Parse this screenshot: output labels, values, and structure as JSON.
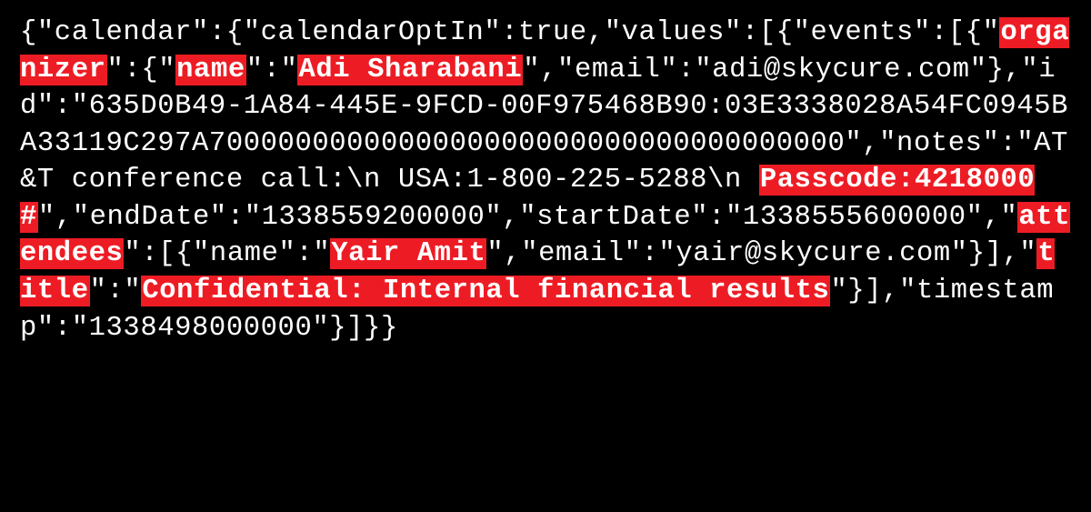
{
  "segments": [
    {
      "t": "{\"calendar\":{\"calendarOptIn\":true,\"values\":[{\"events\":[{\"",
      "hl": false
    },
    {
      "t": "organizer",
      "hl": true
    },
    {
      "t": "\":{\"",
      "hl": false
    },
    {
      "t": "name",
      "hl": true
    },
    {
      "t": "\":\"",
      "hl": false
    },
    {
      "t": "Adi Sharabani",
      "hl": true
    },
    {
      "t": "\",\"email\":\"adi@skycure.com\"},\"id\":\"635D0B49-1A84-445E-9FCD-00F975468B90:03E3338028A54FC0945BA33119C297A7000000000000000000000000000000000000\",\"notes\":\"AT&T conference call:\\n USA:1-800-225-5288\\n ",
      "hl": false
    },
    {
      "t": "Passcode:4218000#",
      "hl": true
    },
    {
      "t": "\",\"endDate\":\"1338559200000\",\"startDate\":\"1338555600000\",\"",
      "hl": false
    },
    {
      "t": "attendees",
      "hl": true
    },
    {
      "t": "\":[{\"name\":\"",
      "hl": false
    },
    {
      "t": "Yair Amit",
      "hl": true
    },
    {
      "t": "\",\"email\":\"yair@skycure.com\"}],\"",
      "hl": false
    },
    {
      "t": "title",
      "hl": true
    },
    {
      "t": "\":\"",
      "hl": false
    },
    {
      "t": "Confidential:  Internal financial results",
      "hl": true
    },
    {
      "t": "\"}],\"timestamp\":\"1338498000000\"}]}}",
      "hl": false
    }
  ]
}
